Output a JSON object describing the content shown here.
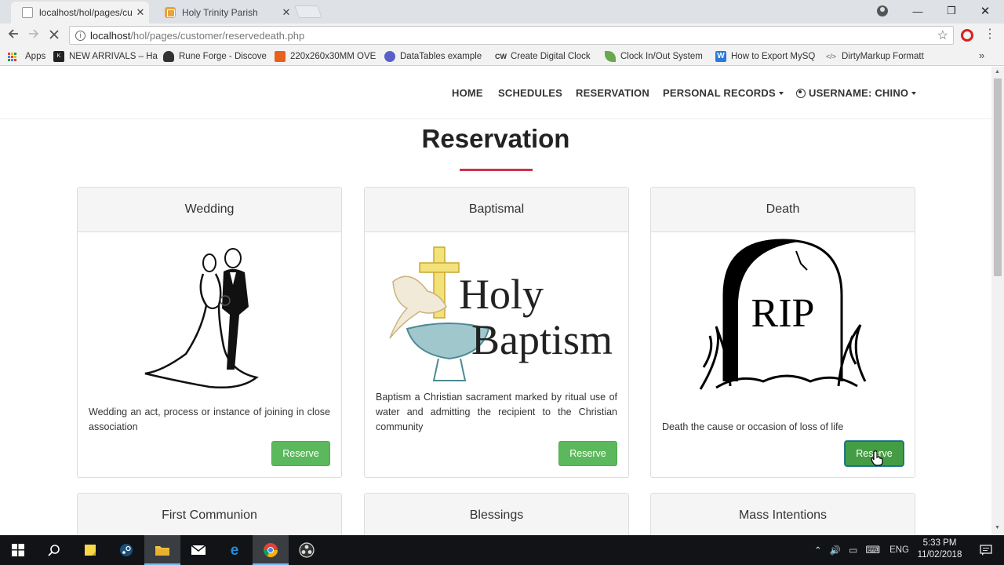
{
  "browser": {
    "tabs": [
      {
        "title": "localhost/hol/pages/cust",
        "close": "✕"
      },
      {
        "title": "Holy Trinity Parish",
        "close": "✕"
      }
    ],
    "url_host": "localhost",
    "url_path": "/hol/pages/customer/reservedeath.php",
    "window_controls": {
      "minimize": "—",
      "maximize": "❐",
      "close": "✕"
    },
    "bookmarks": [
      {
        "label": "Apps",
        "icon": "apps-grid-icon"
      },
      {
        "label": "NEW ARRIVALS – Ha",
        "icon": "bookmark-ebay-icon",
        "color": "#222222"
      },
      {
        "label": "Rune Forge - Discove",
        "icon": "shield-icon",
        "color": "#333333"
      },
      {
        "label": "220x260x30MM OVE",
        "icon": "bookmark-orange-icon",
        "color": "#e8601c"
      },
      {
        "label": "DataTables example",
        "icon": "bookmark-circle-icon",
        "color": "#5a5fc8"
      },
      {
        "label": "Create Digital Clock",
        "icon": "bookmark-cw-icon",
        "color": "#333333"
      },
      {
        "label": "Clock In/Out System",
        "icon": "leaf-icon",
        "color": "#6aa84f"
      },
      {
        "label": "How to Export MySQ",
        "icon": "w-icon",
        "color": "#2b7bd9"
      },
      {
        "label": "DirtyMarkup Formatt",
        "icon": "code-icon",
        "color": "#555555"
      }
    ]
  },
  "site": {
    "nav": {
      "home": "HOME",
      "schedules": "SCHEDULES",
      "reservation": "RESERVATION",
      "personal_records": "PERSONAL RECORDS",
      "username": "USERNAME: CHINO"
    },
    "page_title": "Reservation",
    "accent_color": "#c9354b",
    "button_color": "#5cb85c",
    "cards": [
      {
        "title": "Wedding",
        "desc": "Wedding an act, process or instance of joining in close association",
        "button": "Reserve",
        "icon": "wedding-couple-icon"
      },
      {
        "title": "Baptismal",
        "desc": "Baptism a Christian sacrament marked by ritual use of water and admitting the recipient to the Christian community",
        "button": "Reserve",
        "icon": "holy-baptism-icon",
        "image_text_1": "Holy",
        "image_text_2": "Baptism"
      },
      {
        "title": "Death",
        "desc": "Death the cause or occasion of loss of life",
        "button": "Reserve",
        "icon": "tombstone-rip-icon",
        "image_text": "RIP"
      },
      {
        "title": "First Communion"
      },
      {
        "title": "Blessings"
      },
      {
        "title": "Mass Intentions"
      }
    ]
  },
  "taskbar": {
    "icons": [
      "windows-start-icon",
      "search-icon",
      "sticky-notes-icon",
      "steam-icon",
      "file-explorer-icon",
      "mail-icon",
      "edge-icon",
      "chrome-icon",
      "obs-icon"
    ],
    "language": "ENG",
    "time": "5:33 PM",
    "date": "11/02/2018"
  }
}
